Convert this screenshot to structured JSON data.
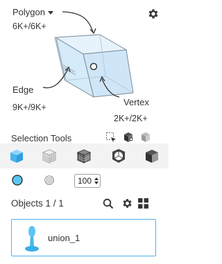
{
  "mesh": {
    "polygon_label": "Polygon",
    "polygon_count": "6K+/6K+",
    "edge_label": "Edge",
    "edge_count": "9K+/9K+",
    "vertex_label": "Vertex",
    "vertex_count": "2K+/2K+"
  },
  "selection_tools": {
    "title": "Selection Tools",
    "brush_size": "100"
  },
  "objects": {
    "title": "Objects 1 / 1",
    "items": [
      {
        "label": "union_1"
      }
    ]
  },
  "colors": {
    "accent": "#4fb3e8",
    "cube_face": "#dceefb",
    "icon_dark": "#3a3a3a"
  }
}
